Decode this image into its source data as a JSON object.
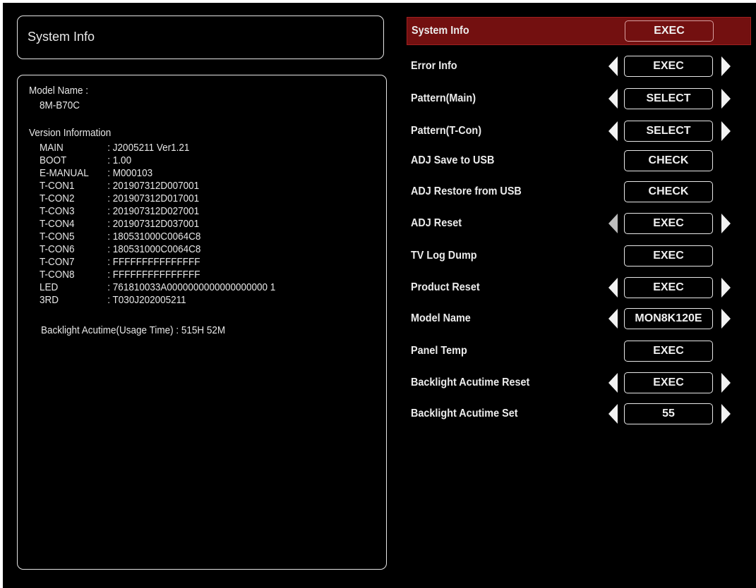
{
  "left": {
    "title": "System Info",
    "model_label": "Model Name :",
    "model_value": "8M-B70C",
    "version_heading": "Version Information",
    "versions": [
      {
        "key": "MAIN",
        "value": ": J2005211    Ver1.21"
      },
      {
        "key": "BOOT",
        "value": ": 1.00"
      },
      {
        "key": "E-MANUAL",
        "value": ": M000103"
      },
      {
        "key": "T-CON1",
        "value": ": 201907312D007001"
      },
      {
        "key": "T-CON2",
        "value": ": 201907312D017001"
      },
      {
        "key": "T-CON3",
        "value": ": 201907312D027001"
      },
      {
        "key": "T-CON4",
        "value": ": 201907312D037001"
      },
      {
        "key": "T-CON5",
        "value": ": 180531000C0064C8"
      },
      {
        "key": "T-CON6",
        "value": ": 180531000C0064C8"
      },
      {
        "key": "T-CON7",
        "value": ": FFFFFFFFFFFFFFF"
      },
      {
        "key": "T-CON8",
        "value": ": FFFFFFFFFFFFFFF"
      },
      {
        "key": "LED",
        "value": ": 761810033A0000000000000000000  1"
      },
      {
        "key": "3RD",
        "value": ": T030J202005211"
      }
    ],
    "backlight": "Backlight Acutime(Usage Time) : 515H 52M"
  },
  "menu": [
    {
      "label": "System Info",
      "button": "EXEC",
      "selected": true
    },
    {
      "label": "Error Info",
      "button": "EXEC",
      "arrows": true
    },
    {
      "label": "Pattern(Main)",
      "button": "SELECT",
      "arrows": true
    },
    {
      "label": "Pattern(T-Con)",
      "button": "SELECT",
      "arrows": true
    },
    {
      "label": "ADJ Save to USB",
      "button": "CHECK"
    },
    {
      "label": "ADJ Restore from USB",
      "button": "CHECK"
    },
    {
      "label": "ADJ Reset",
      "button": "EXEC",
      "arrows": true
    },
    {
      "label": "TV Log Dump",
      "button": "EXEC"
    },
    {
      "label": "Product Reset",
      "button": "EXEC",
      "arrows": true
    },
    {
      "label": "Model Name",
      "button": "MON8K120E",
      "arrows": true
    },
    {
      "label": "Panel Temp",
      "button": "EXEC"
    },
    {
      "label": "Backlight Acutime Reset",
      "button": "EXEC",
      "arrows": true
    },
    {
      "label": "Backlight Acutime Set",
      "button": "55",
      "arrows": true
    }
  ],
  "colors": {
    "background": "#000000",
    "selected_row": "#731010",
    "text": "#e6e6e6"
  }
}
